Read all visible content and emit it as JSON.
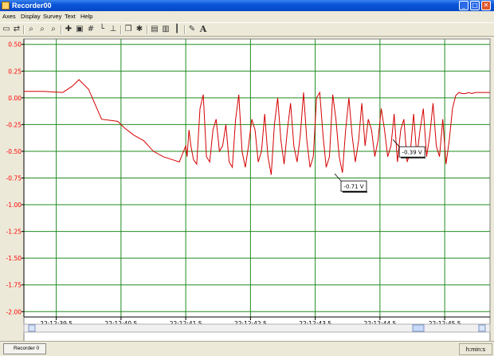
{
  "window": {
    "title": "Recorder00",
    "buttons": {
      "minimize": "_",
      "maximize": "□",
      "close": "✕"
    }
  },
  "menu": [
    "Axes",
    "Display",
    "Survey",
    "Text",
    "Help"
  ],
  "toolbar": {
    "icons": [
      "view-icon",
      "arrow-icon",
      "zoom-in-icon",
      "zoom-fit-icon",
      "zoom-out-icon",
      "cross-icon",
      "save-icon",
      "grid-icon",
      "lin-icon",
      "axis-icon",
      "copy-icon",
      "cursor-icon",
      "window-icon",
      "window2-icon",
      "bars-icon",
      "brush-icon",
      "font-icon"
    ],
    "font_label": "A"
  },
  "colors": {
    "grid": "#228b22",
    "trace": "#d40000",
    "axis_text": "#ff0000",
    "plot_bg": "#ffffff"
  },
  "chart_data": {
    "type": "line",
    "title": "",
    "xlabel": "",
    "ylabel": "",
    "y_ticks": [
      "0.50",
      "0.25",
      "0.00",
      "-0.25",
      "-0.50",
      "-0.75",
      "-1.00",
      "-1.25",
      "-1.50",
      "-1.75",
      "-2.00"
    ],
    "x_ticks": [
      "22:12:39.5",
      "22:12:40.5",
      "22:12:41.5",
      "22:12:42.5",
      "22:12:43.5",
      "22:12:44.5",
      "22:12:45.5"
    ],
    "ylim": [
      -2.05,
      0.55
    ],
    "xlim_seconds": [
      39.0,
      46.2
    ],
    "grid": true,
    "series": [
      {
        "x": [
          39.0,
          39.3,
          39.6,
          39.75,
          39.85,
          40.0,
          40.2,
          40.45,
          40.55,
          40.7,
          40.85,
          41.0,
          41.15,
          41.3,
          41.4,
          41.5,
          41.52,
          41.55,
          41.58,
          41.62,
          41.67,
          41.72,
          41.77,
          41.82,
          41.87,
          41.92,
          41.97,
          42.02,
          42.07,
          42.12,
          42.17,
          42.22,
          42.27,
          42.32,
          42.37,
          42.42,
          42.47,
          42.52,
          42.57,
          42.62,
          42.67,
          42.72,
          42.77,
          42.82,
          42.87,
          42.92,
          42.97,
          43.02,
          43.07,
          43.12,
          43.17,
          43.22,
          43.27,
          43.32,
          43.37,
          43.42,
          43.47,
          43.52,
          43.57,
          43.62,
          43.67,
          43.72,
          43.77,
          43.82,
          43.87,
          43.92,
          43.97,
          44.02,
          44.07,
          44.12,
          44.17,
          44.22,
          44.27,
          44.32,
          44.37,
          44.42,
          44.47,
          44.52,
          44.57,
          44.62,
          44.67,
          44.72,
          44.77,
          44.82,
          44.87,
          44.92,
          44.97,
          45.02,
          45.07,
          45.12,
          45.17,
          45.22,
          45.27,
          45.32,
          45.37,
          45.42,
          45.47,
          45.52,
          45.57,
          45.62,
          45.67,
          45.72,
          45.77,
          45.82,
          45.87,
          45.92,
          45.97,
          46.1,
          46.2
        ],
        "y": [
          0.06,
          0.06,
          0.05,
          0.11,
          0.17,
          0.08,
          -0.2,
          -0.22,
          -0.28,
          -0.35,
          -0.4,
          -0.5,
          -0.55,
          -0.58,
          -0.6,
          -0.45,
          -0.55,
          -0.3,
          -0.45,
          -0.58,
          -0.62,
          -0.1,
          0.03,
          -0.55,
          -0.6,
          -0.3,
          -0.2,
          -0.5,
          -0.45,
          -0.25,
          -0.6,
          -0.65,
          -0.2,
          0.03,
          -0.5,
          -0.65,
          -0.45,
          -0.2,
          -0.3,
          -0.6,
          -0.5,
          -0.15,
          -0.55,
          -0.72,
          -0.25,
          0.0,
          -0.4,
          -0.62,
          -0.3,
          -0.05,
          -0.45,
          -0.6,
          -0.35,
          0.05,
          -0.4,
          -0.65,
          -0.55,
          0.0,
          0.05,
          -0.35,
          -0.65,
          -0.55,
          0.03,
          -0.2,
          -0.55,
          -0.7,
          -0.3,
          0.0,
          -0.35,
          -0.6,
          -0.4,
          -0.05,
          -0.45,
          -0.2,
          -0.3,
          -0.55,
          -0.4,
          -0.1,
          -0.3,
          -0.55,
          -0.45,
          -0.15,
          -0.6,
          -0.3,
          -0.2,
          -0.6,
          -0.5,
          -0.15,
          -0.55,
          -0.3,
          -0.1,
          -0.55,
          -0.35,
          -0.05,
          -0.45,
          -0.55,
          -0.2,
          -0.62,
          -0.4,
          -0.1,
          0.02,
          0.05,
          0.04,
          0.04,
          0.05,
          0.04,
          0.05,
          0.05,
          0.05
        ]
      }
    ],
    "annotations": [
      {
        "label": "-0.71 V",
        "x": 43.8,
        "y": -0.71
      },
      {
        "label": "-0.39 V",
        "x": 44.7,
        "y": -0.39
      }
    ]
  },
  "status": {
    "task": "Recorder 0",
    "units": "h:min:s"
  }
}
